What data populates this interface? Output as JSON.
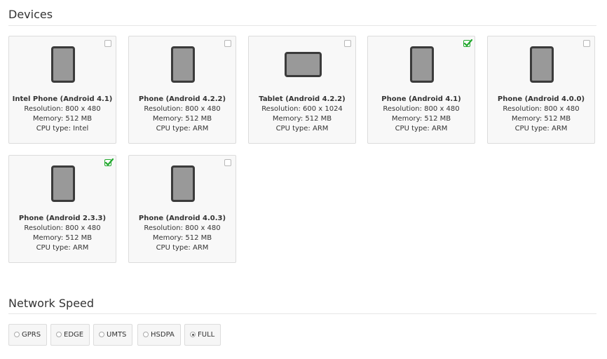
{
  "devices_section": {
    "title": "Devices"
  },
  "devices": [
    {
      "name": "Intel Phone (Android 4.1)",
      "resolution": "Resolution: 800 x 480",
      "memory": "Memory: 512 MB",
      "cpu": "CPU type: Intel",
      "form": "phone",
      "checked": false
    },
    {
      "name": "Phone (Android 4.2.2)",
      "resolution": "Resolution: 800 x 480",
      "memory": "Memory: 512 MB",
      "cpu": "CPU type: ARM",
      "form": "phone",
      "checked": false
    },
    {
      "name": "Tablet (Android 4.2.2)",
      "resolution": "Resolution: 600 x 1024",
      "memory": "Memory: 512 MB",
      "cpu": "CPU type: ARM",
      "form": "tablet",
      "checked": false
    },
    {
      "name": "Phone (Android 4.1)",
      "resolution": "Resolution: 800 x 480",
      "memory": "Memory: 512 MB",
      "cpu": "CPU type: ARM",
      "form": "phone",
      "checked": true
    },
    {
      "name": "Phone (Android 4.0.0)",
      "resolution": "Resolution: 800 x 480",
      "memory": "Memory: 512 MB",
      "cpu": "CPU type: ARM",
      "form": "phone",
      "checked": false
    },
    {
      "name": "Phone (Android 2.3.3)",
      "resolution": "Resolution: 800 x 480",
      "memory": "Memory: 512 MB",
      "cpu": "CPU type: ARM",
      "form": "phone",
      "checked": true
    },
    {
      "name": "Phone (Android 4.0.3)",
      "resolution": "Resolution: 800 x 480",
      "memory": "Memory: 512 MB",
      "cpu": "CPU type: ARM",
      "form": "phone",
      "checked": false
    }
  ],
  "network_section": {
    "title": "Network Speed"
  },
  "network_speeds": [
    {
      "label": "GPRS",
      "selected": false
    },
    {
      "label": "EDGE",
      "selected": false
    },
    {
      "label": "UMTS",
      "selected": false
    },
    {
      "label": "HSDPA",
      "selected": false
    },
    {
      "label": "FULL",
      "selected": true
    }
  ],
  "colors": {
    "check_green": "#22a82e",
    "card_bg": "#f8f8f8",
    "device_screen": "#999999",
    "device_frame": "#3b3b3b"
  },
  "icons": {
    "checkbox_checked": "check-icon",
    "phone": "phone-icon",
    "tablet": "tablet-icon"
  }
}
